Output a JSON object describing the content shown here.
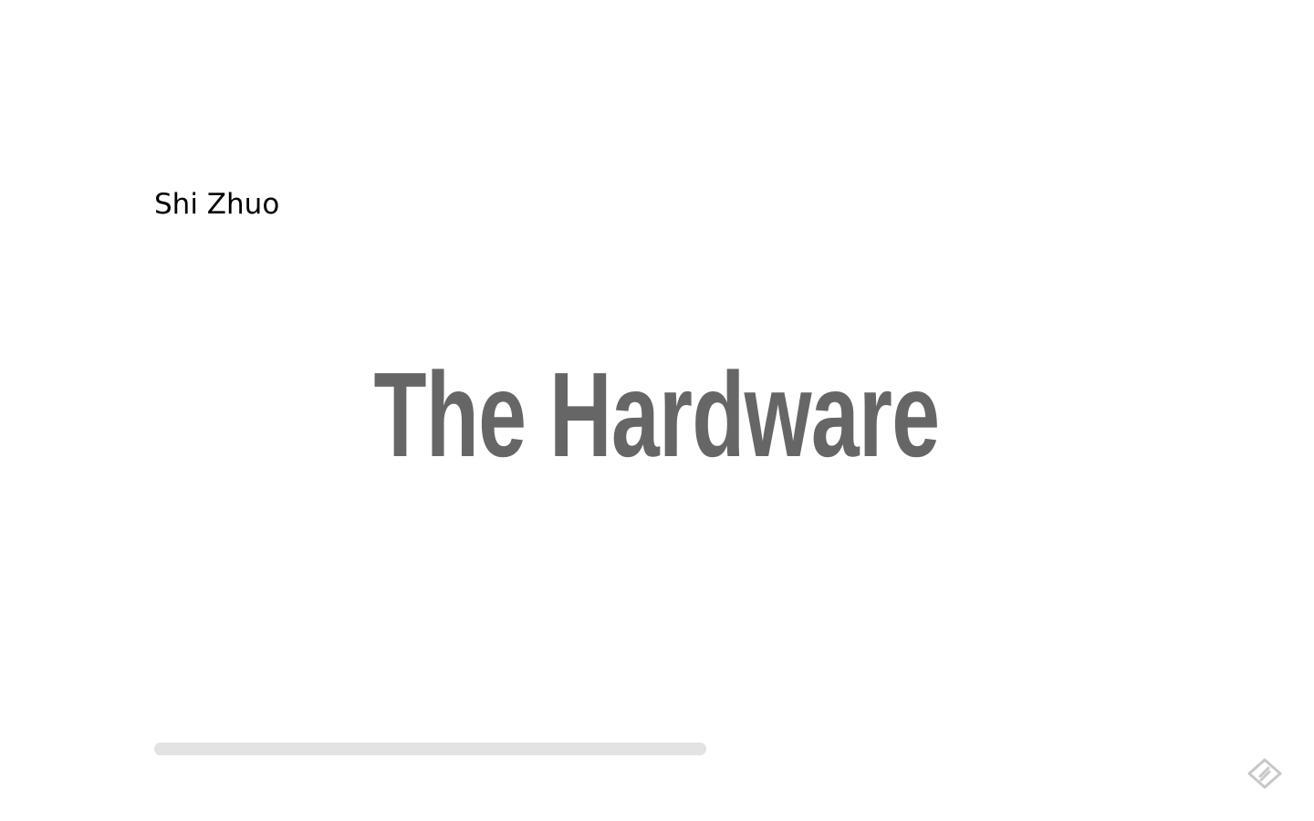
{
  "slide": {
    "author": "Shi Zhuo",
    "title": "The Hardware"
  },
  "progress": {
    "fraction": 1.0
  },
  "icons": {
    "logo": "presentation-logo-icon"
  },
  "colors": {
    "title": "#666666",
    "author": "#000000",
    "progress_track": "#e3e3e3",
    "logo": "#c8c8c8",
    "background": "#ffffff"
  }
}
